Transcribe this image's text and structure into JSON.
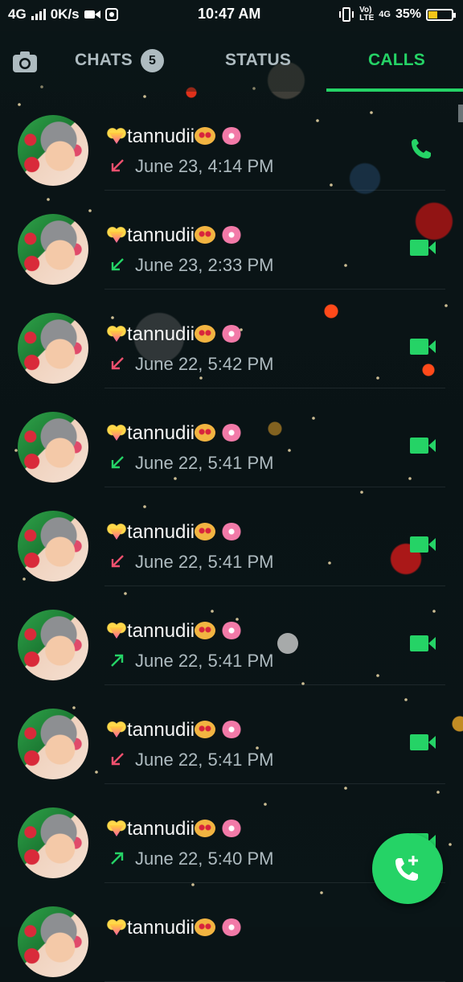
{
  "status_bar": {
    "network": "4G",
    "speed": "0K/s",
    "time": "10:47 AM",
    "volte_top": "Vo)",
    "volte_bottom": "LTE",
    "network_right": "4G",
    "battery": "35%",
    "battery_level": 0.35
  },
  "tabs": {
    "camera_icon": "camera-icon",
    "chats_label": "CHATS",
    "chats_badge": "5",
    "status_label": "STATUS",
    "calls_label": "CALLS",
    "active_tab": "CALLS",
    "accent_color": "#25d366"
  },
  "calls": [
    {
      "name": "tannudii",
      "time": "June 23, 4:14 PM",
      "direction": "missed-incoming",
      "type": "voice"
    },
    {
      "name": "tannudii",
      "time": "June 23, 2:33 PM",
      "direction": "incoming",
      "type": "video"
    },
    {
      "name": "tannudii",
      "time": "June 22, 5:42 PM",
      "direction": "missed-incoming",
      "type": "video"
    },
    {
      "name": "tannudii",
      "time": "June 22, 5:41 PM",
      "direction": "incoming",
      "type": "video"
    },
    {
      "name": "tannudii",
      "time": "June 22, 5:41 PM",
      "direction": "missed-incoming",
      "type": "video"
    },
    {
      "name": "tannudii",
      "time": "June 22, 5:41 PM",
      "direction": "outgoing",
      "type": "video"
    },
    {
      "name": "tannudii",
      "time": "June 22, 5:41 PM",
      "direction": "missed-incoming",
      "type": "video"
    },
    {
      "name": "tannudii",
      "time": "June 22, 5:40 PM",
      "direction": "outgoing",
      "type": "video"
    },
    {
      "name": "tannudii",
      "time": "",
      "direction": "",
      "type": ""
    }
  ],
  "fab": {
    "icon": "new-call-icon"
  }
}
